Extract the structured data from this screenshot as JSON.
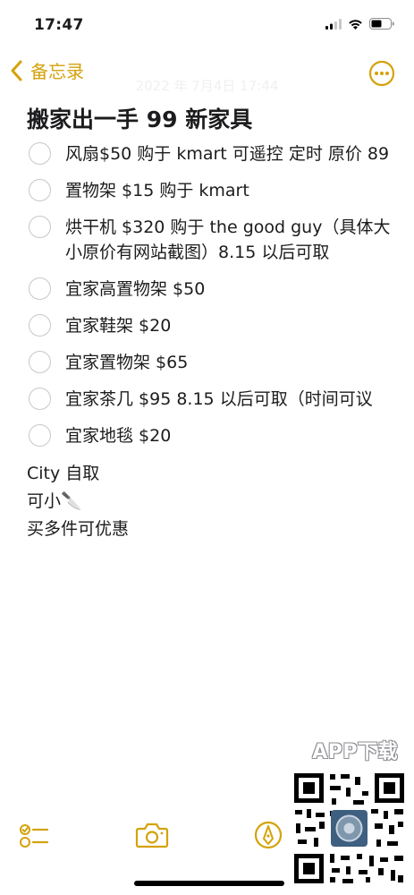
{
  "status_bar": {
    "time": "17:47"
  },
  "nav": {
    "back_label": "备忘录",
    "date": "2022 年 7月4日 17:44"
  },
  "note": {
    "title": "搬家出一手 99 新家具",
    "checklist": [
      {
        "text": "风扇$50 购于 kmart 可遥控 定时 原价 89",
        "checked": false
      },
      {
        "text": "置物架 $15 购于 kmart",
        "checked": false
      },
      {
        "text": "烘干机 $320 购于 the good guy（具体大小原价有网站截图）8.15 以后可取",
        "checked": false
      },
      {
        "text": "宜家高置物架 $50",
        "checked": false
      },
      {
        "text": "宜家鞋架 $20",
        "checked": false
      },
      {
        "text": "宜家置物架 $65",
        "checked": false
      },
      {
        "text": "宜家茶几 $95   8.15 以后可取（时间可议",
        "checked": false
      },
      {
        "text": "宜家地毯 $20",
        "checked": false
      }
    ],
    "lines": [
      "City 自取",
      "可小",
      "买多件可优惠"
    ],
    "knife_emoji": "🔪"
  },
  "watermark": {
    "label": "APP下载"
  },
  "colors": {
    "accent": "#d4a20a",
    "circle": "#c7c7cc",
    "text": "#1c1c1e"
  },
  "icons": {
    "back": "chevron-left-icon",
    "more": "ellipsis-circle-icon",
    "checklist": "checklist-icon",
    "camera": "camera-icon",
    "markup": "pen-circle-icon"
  }
}
